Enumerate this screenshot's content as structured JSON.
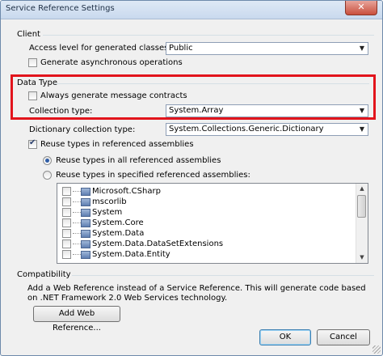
{
  "window": {
    "title": "Service Reference Settings",
    "close_glyph": "✕"
  },
  "client": {
    "group_label": "Client",
    "access_level_label": "Access level for generated classes:",
    "access_level_value": "Public",
    "async_label": "Generate asynchronous operations",
    "async_checked": false
  },
  "data_type": {
    "group_label": "Data Type",
    "message_contracts_label": "Always generate message contracts",
    "message_contracts_checked": false,
    "collection_type_label": "Collection type:",
    "collection_type_value": "System.Array",
    "dictionary_type_label": "Dictionary collection type:",
    "dictionary_type_value": "System.Collections.Generic.Dictionary",
    "reuse_types_label": "Reuse types in referenced assemblies",
    "reuse_types_checked": true,
    "reuse_all_label": "Reuse types in all referenced assemblies",
    "reuse_specified_label": "Reuse types in specified referenced assemblies:",
    "selected_radio": "all",
    "assemblies": [
      {
        "name": "Microsoft.CSharp",
        "checked": false
      },
      {
        "name": "mscorlib",
        "checked": false
      },
      {
        "name": "System",
        "checked": false
      },
      {
        "name": "System.Core",
        "checked": false
      },
      {
        "name": "System.Data",
        "checked": false
      },
      {
        "name": "System.Data.DataSetExtensions",
        "checked": false
      },
      {
        "name": "System.Data.Entity",
        "checked": false
      }
    ]
  },
  "compatibility": {
    "group_label": "Compatibility",
    "description": "Add a Web Reference instead of a Service Reference. This will generate code based on .NET Framework 2.0 Web Services technology.",
    "add_web_reference_label": "Add Web Reference..."
  },
  "buttons": {
    "ok_label": "OK",
    "cancel_label": "Cancel"
  },
  "colors": {
    "highlight_border": "#e2141c",
    "title_bar": "#c9d9ee"
  },
  "glyphs": {
    "dropdown_arrow": "▼",
    "scroll_up": "▲",
    "scroll_down": "▼"
  }
}
